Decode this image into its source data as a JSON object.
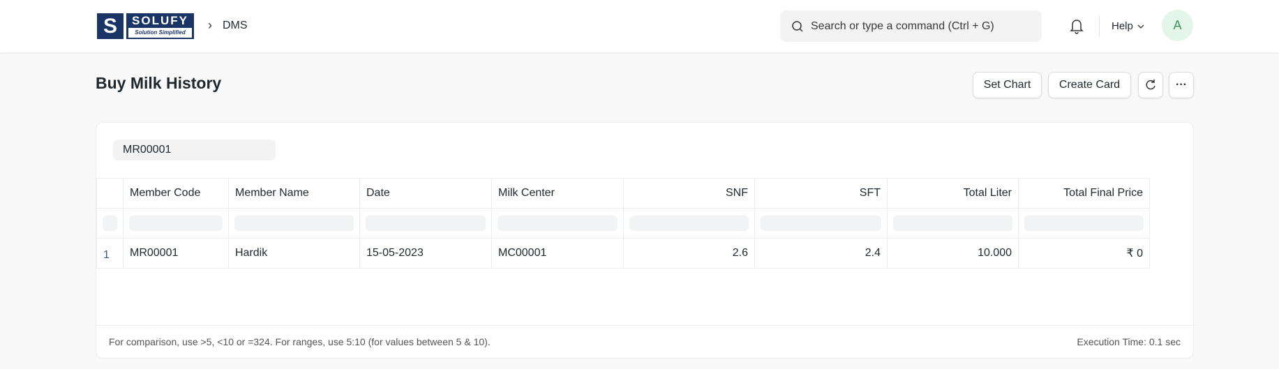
{
  "header": {
    "logo": {
      "mark": "S",
      "name": "SOLUFY",
      "tagline": "Solution Simplified"
    },
    "breadcrumb": "DMS",
    "search_placeholder": "Search or type a command (Ctrl + G)",
    "help_label": "Help",
    "avatar_initial": "A"
  },
  "page": {
    "title": "Buy Milk History",
    "buttons": {
      "set_chart": "Set Chart",
      "create_card": "Create Card",
      "refresh_icon": "refresh-icon",
      "more_label": "···"
    }
  },
  "filter": {
    "value": "MR00001"
  },
  "table": {
    "columns": [
      "Member Code",
      "Member Name",
      "Date",
      "Milk Center",
      "SNF",
      "SFT",
      "Total Liter",
      "Total Final Price"
    ],
    "rows": [
      {
        "index": "1",
        "cells": [
          "MR00001",
          "Hardik",
          "15-05-2023",
          "MC00001",
          "2.6",
          "2.4",
          "10.000",
          "₹ 0"
        ]
      }
    ]
  },
  "footer": {
    "hint": "For comparison, use >5, <10 or =324. For ranges, use 5:10 (for values between 5 & 10).",
    "execution_time": "Execution Time: 0.1 sec"
  }
}
